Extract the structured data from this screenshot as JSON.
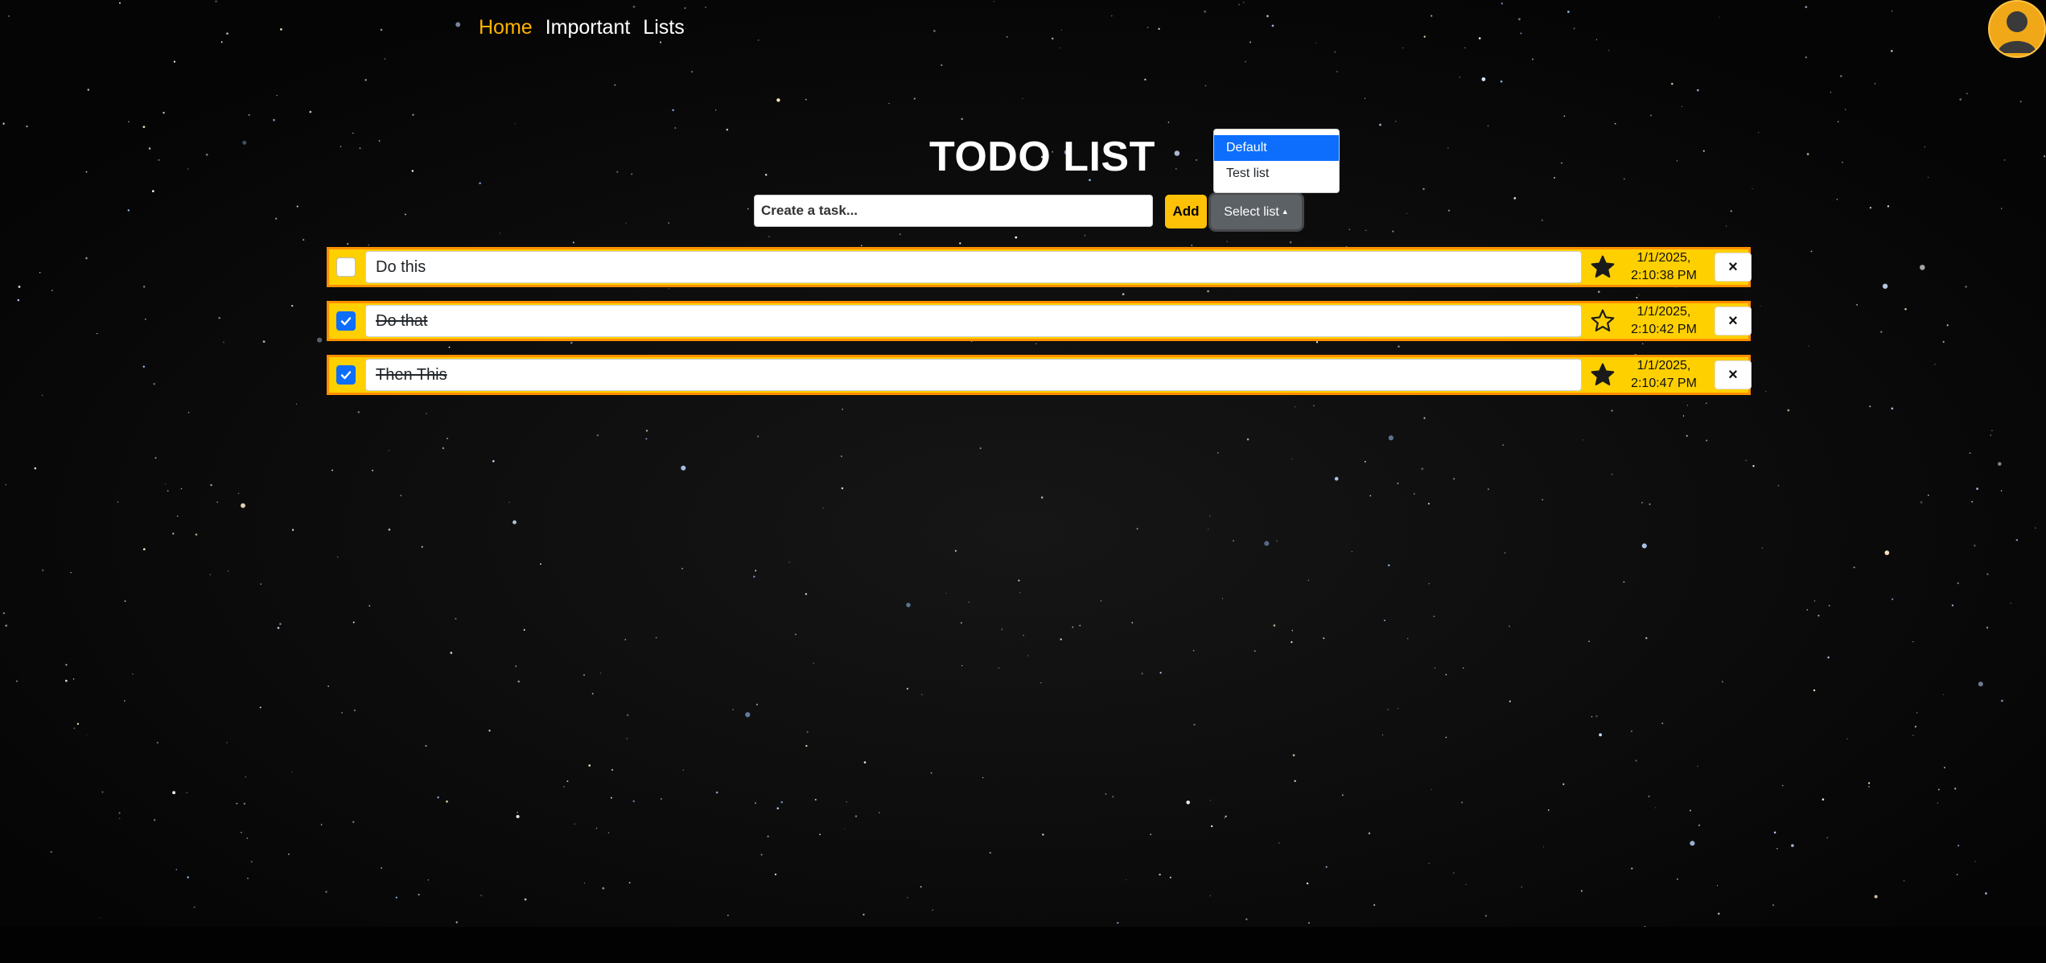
{
  "nav": {
    "items": [
      {
        "label": "Home",
        "active": true
      },
      {
        "label": "Important",
        "active": false
      },
      {
        "label": "Lists",
        "active": false
      }
    ]
  },
  "title": "TODO LIST",
  "create": {
    "placeholder": "Create a task...",
    "add_label": "Add",
    "select_label": "Select list"
  },
  "dropdown": {
    "options": [
      {
        "label": "Default",
        "selected": true
      },
      {
        "label": "Test list",
        "selected": false
      }
    ]
  },
  "todos": [
    {
      "text": "Do this",
      "done": false,
      "important": true,
      "date": "1/1/2025,",
      "time": "2:10:38 PM"
    },
    {
      "text": "Do that",
      "done": true,
      "important": false,
      "date": "1/1/2025,",
      "time": "2:10:42 PM"
    },
    {
      "text": "Then This",
      "done": true,
      "important": true,
      "date": "1/1/2025,",
      "time": "2:10:47 PM"
    }
  ],
  "icons": {
    "star_filled": "star-filled-icon",
    "star_outline": "star-outline-icon",
    "close": "close-icon",
    "check": "check-icon",
    "avatar": "user-avatar-icon"
  },
  "colors": {
    "nav_active": "#ffb300",
    "row_fill": "#ffd000",
    "row_border": "#ff8f00",
    "add_button": "#ffc107",
    "select_button": "#5c6166",
    "checkbox_checked": "#0d6efd",
    "dropdown_selected": "#0d6efd"
  },
  "delete_label": "×"
}
